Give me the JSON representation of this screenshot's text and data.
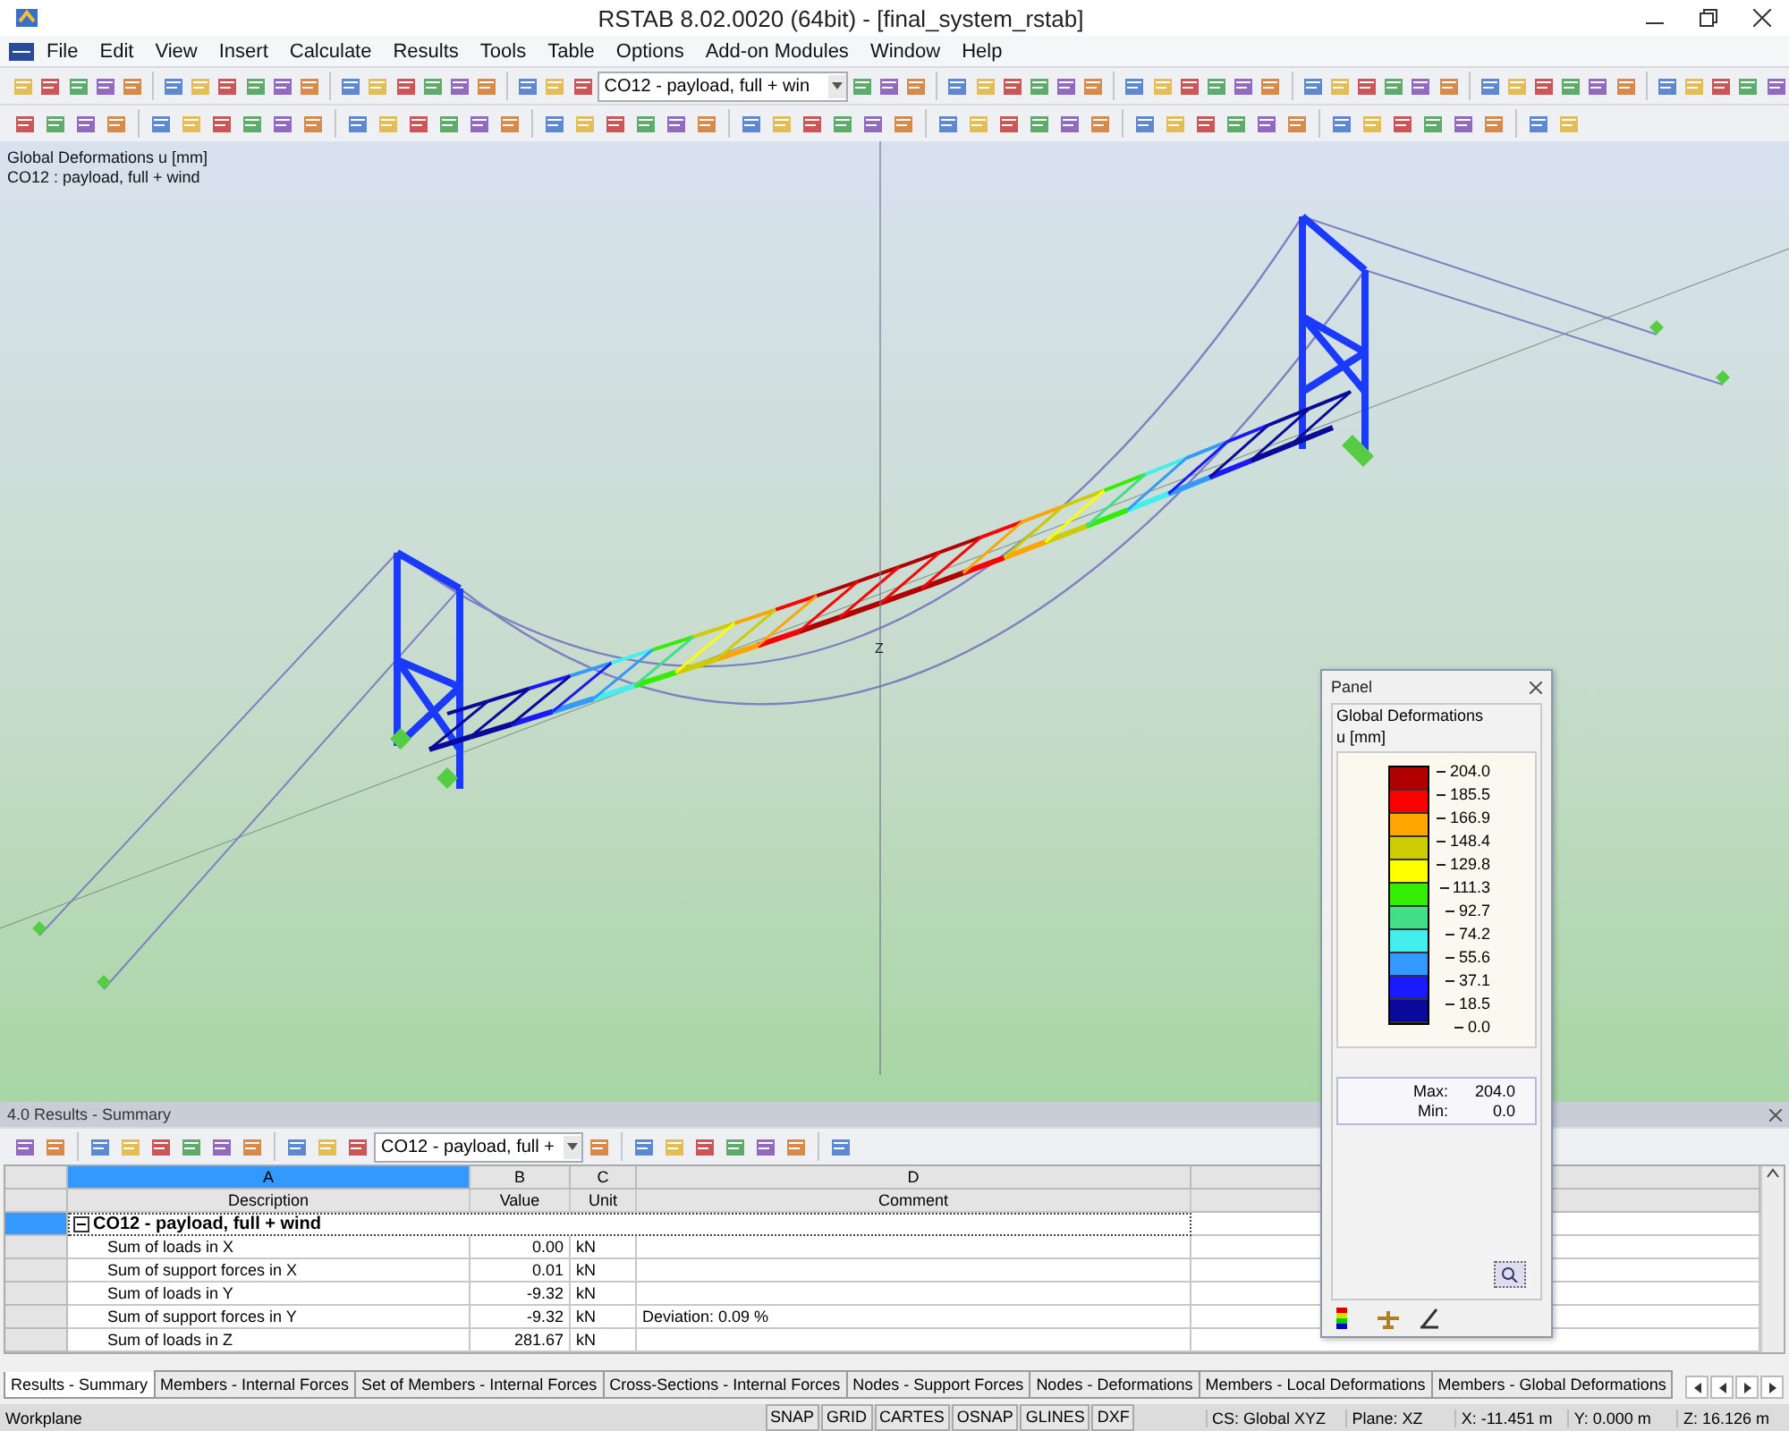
{
  "window": {
    "title": "RSTAB 8.02.0020 (64bit) - [final_system_rstab]"
  },
  "menu": [
    "File",
    "Edit",
    "View",
    "Insert",
    "Calculate",
    "Results",
    "Tools",
    "Table",
    "Options",
    "Add-on Modules",
    "Window",
    "Help"
  ],
  "toolbar": {
    "combo": "CO12 - payload, full + win"
  },
  "viewport": {
    "info": [
      "Global Deformations u [mm]",
      "CO12 : payload, full + wind"
    ],
    "axis_label": "Z"
  },
  "panel": {
    "title": "Panel",
    "heading": "Global Deformations",
    "unit": "u [mm]",
    "ticks": [
      "204.0",
      "185.5",
      "166.9",
      "148.4",
      "129.8",
      "111.3",
      "92.7",
      "74.2",
      "55.6",
      "37.1",
      "18.5",
      "0.0"
    ],
    "bands": [
      {
        "color": "#b00000"
      },
      {
        "color": "#ff0000"
      },
      {
        "color": "#ffa500"
      },
      {
        "color": "#cccc00"
      },
      {
        "color": "#ffff00"
      },
      {
        "color": "#33ee00"
      },
      {
        "color": "#44dd88"
      },
      {
        "color": "#44eeee"
      },
      {
        "color": "#3399ff"
      },
      {
        "color": "#1a1aff"
      },
      {
        "color": "#0a0a9a"
      }
    ],
    "separator": ":",
    "max_label": "Max",
    "max_value": "204.0",
    "min_label": "Min",
    "min_value": "0.0"
  },
  "results": {
    "title": "4.0 Results - Summary",
    "combo": "CO12 - payload, full +",
    "columns": [
      {
        "letter": "A",
        "label": "Description"
      },
      {
        "letter": "B",
        "label": "Value"
      },
      {
        "letter": "C",
        "label": "Unit"
      },
      {
        "letter": "D",
        "label": "Comment"
      }
    ],
    "group": {
      "label": "CO12 - payload, full + wind",
      "expanded": true,
      "selected": true
    },
    "rows": [
      {
        "description": "Sum of loads in X",
        "value": "0.00",
        "unit": "kN",
        "comment": ""
      },
      {
        "description": "Sum of support forces in X",
        "value": "0.01",
        "unit": "kN",
        "comment": ""
      },
      {
        "description": "Sum of loads in Y",
        "value": "-9.32",
        "unit": "kN",
        "comment": ""
      },
      {
        "description": "Sum of support forces in Y",
        "value": "-9.32",
        "unit": "kN",
        "comment": "Deviation:  0.09 %"
      },
      {
        "description": "Sum of loads in Z",
        "value": "281.67",
        "unit": "kN",
        "comment": ""
      }
    ],
    "tabs": [
      {
        "label": "Results - Summary",
        "selected": true
      },
      {
        "label": "Members - Internal Forces",
        "selected": false
      },
      {
        "label": "Set of Members - Internal Forces",
        "selected": false
      },
      {
        "label": "Cross-Sections - Internal Forces",
        "selected": false
      },
      {
        "label": "Nodes - Support Forces",
        "selected": false
      },
      {
        "label": "Nodes - Deformations",
        "selected": false
      },
      {
        "label": "Members - Local Deformations",
        "selected": false
      },
      {
        "label": "Members - Global Deformations",
        "selected": false
      }
    ]
  },
  "status_bar": {
    "left": "Workplane",
    "toggles": [
      "SNAP",
      "GRID",
      "CARTES",
      "OSNAP",
      "GLINES",
      "DXF"
    ],
    "fields": [
      "CS: Global XYZ",
      "Plane: XZ",
      "X:  -11.451 m",
      "Y:  0.000 m",
      "Z:  16.126 m"
    ]
  }
}
